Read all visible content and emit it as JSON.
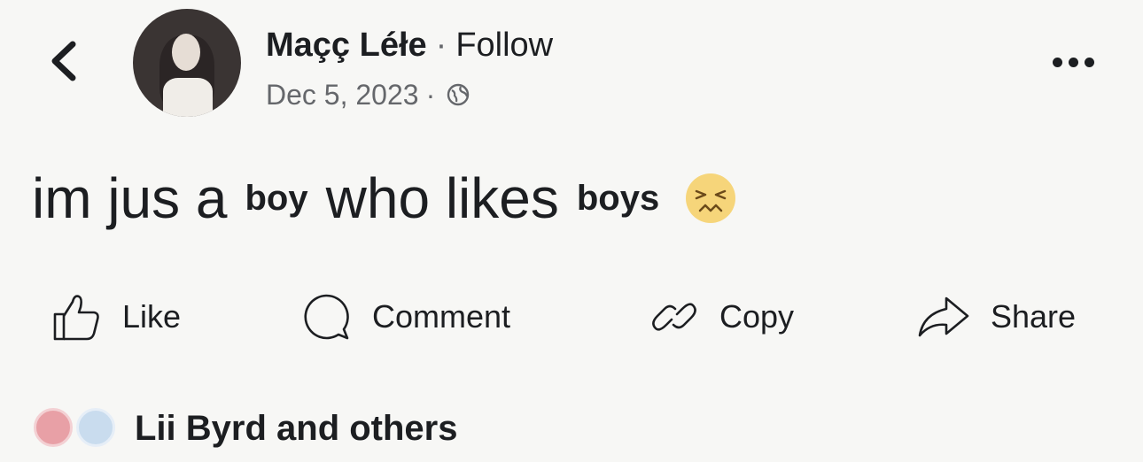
{
  "post": {
    "author": "Maçç Léłe",
    "separator": "·",
    "follow_label": "Follow",
    "date": "Dec 5, 2023",
    "date_separator": "·",
    "privacy_icon": "globe-icon",
    "text": {
      "part1": "im jus a",
      "bold1": "boy",
      "part2": "who likes",
      "bold2": "boys",
      "emoji": "confounded-face"
    }
  },
  "actions": {
    "like": "Like",
    "comment": "Comment",
    "copy": "Copy",
    "share": "Share"
  },
  "reactions": {
    "icons": [
      "love-reaction",
      "care-reaction"
    ],
    "summary": "Lii Byrd and others"
  }
}
